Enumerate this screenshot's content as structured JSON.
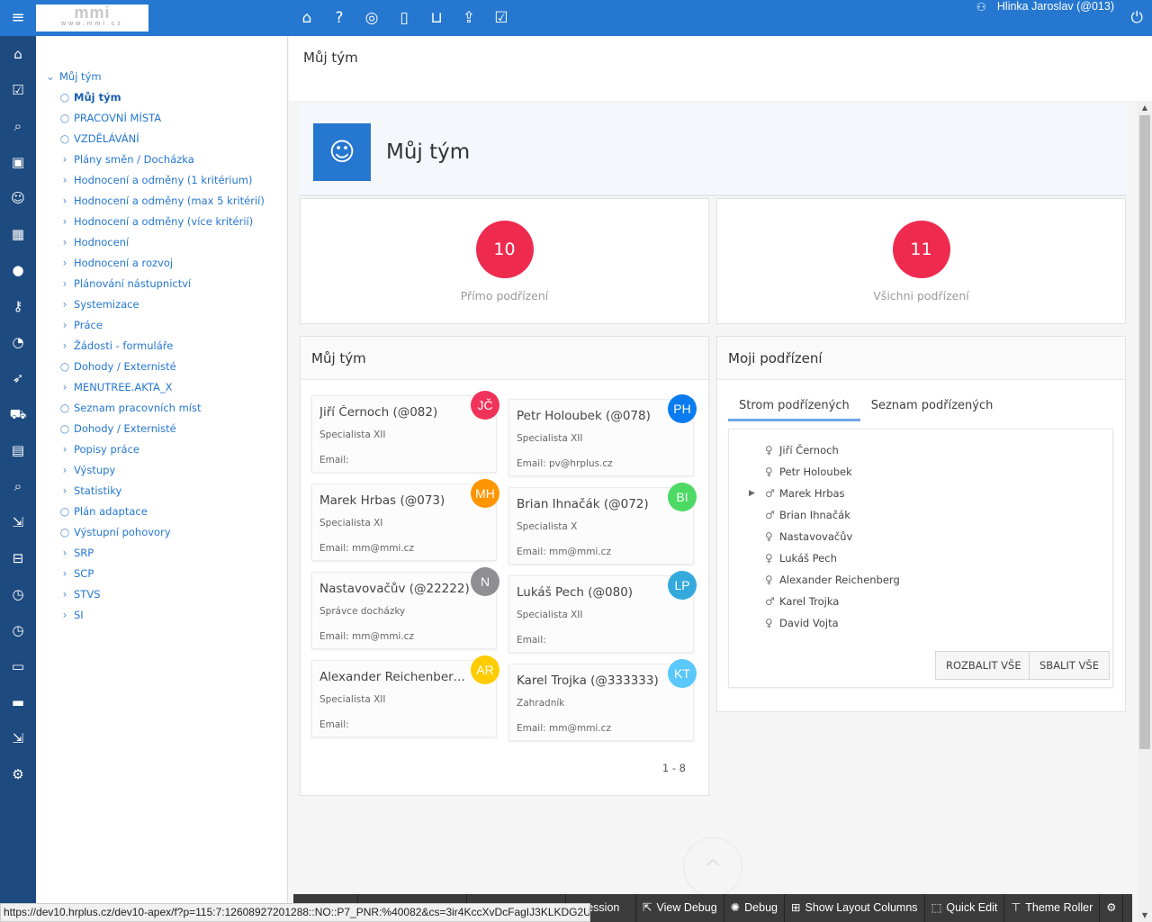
{
  "topbar": {
    "logo_text": "mmi",
    "logo_sub": "www.mmi.cz",
    "icons": [
      "home-icon",
      "help-icon",
      "lifebuoy-icon",
      "book-icon",
      "inbox-icon",
      "window-upload-icon",
      "window-check-icon"
    ],
    "user": "Hlinka Jaroslav (@013)"
  },
  "rail": [
    "home-icon",
    "window-check-icon",
    "window-search-icon",
    "contact-card-icon",
    "team-icon",
    "building-icon",
    "user-circle-icon",
    "user-key-icon",
    "dashboard-icon",
    "rocket-icon",
    "car-icon",
    "train-icon",
    "window-search-icon",
    "window-arrow-icon",
    "briefcase-icon",
    "clock-icon",
    "clock-icon",
    "money-icon",
    "ticket-icon",
    "window-arrow-icon",
    "gear-icon"
  ],
  "nav": [
    {
      "t": "root",
      "label": "Můj tým"
    },
    {
      "t": "circle",
      "label": "Můj tým",
      "active": true
    },
    {
      "t": "circle",
      "label": "PRACOVNÍ MÍSTA"
    },
    {
      "t": "circle",
      "label": "VZDĚLÁVÁNÍ"
    },
    {
      "t": "chev",
      "label": "Plány směn / Docházka"
    },
    {
      "t": "chev",
      "label": "Hodnocení a odměny (1 kritérium)"
    },
    {
      "t": "chev",
      "label": "Hodnocení a odměny (max 5 kritérií)"
    },
    {
      "t": "chev",
      "label": "Hodnocení a odměny (více kritérií)"
    },
    {
      "t": "chev",
      "label": "Hodnocení"
    },
    {
      "t": "chev",
      "label": "Hodnocení a rozvoj"
    },
    {
      "t": "chev",
      "label": "Plánování nástupnictví"
    },
    {
      "t": "chev",
      "label": "Systemizace"
    },
    {
      "t": "chev",
      "label": "Práce"
    },
    {
      "t": "chev",
      "label": "Žádosti - formuláře"
    },
    {
      "t": "circle",
      "label": "Dohody / Externisté"
    },
    {
      "t": "chev",
      "label": "MENUTREE.AKTA_X"
    },
    {
      "t": "circle",
      "label": "Seznam pracovních míst"
    },
    {
      "t": "circle",
      "label": "Dohody / Externisté"
    },
    {
      "t": "chev",
      "label": "Popisy práce"
    },
    {
      "t": "chev",
      "label": "Výstupy"
    },
    {
      "t": "chev",
      "label": "Statistiky"
    },
    {
      "t": "circle",
      "label": "Plán adaptace"
    },
    {
      "t": "circle",
      "label": "Výstupní pohovory"
    },
    {
      "t": "chev",
      "label": "SRP"
    },
    {
      "t": "chev",
      "label": "SCP"
    },
    {
      "t": "chev",
      "label": "STVS"
    },
    {
      "t": "chev",
      "label": "SI"
    }
  ],
  "breadcrumb": "Můj tým",
  "hero": {
    "title": "Můj tým",
    "icon": "team-icon"
  },
  "stats": [
    {
      "value": "10",
      "label": "Přímo podřízení"
    },
    {
      "value": "11",
      "label": "Všichni podřízení"
    }
  ],
  "team": {
    "title": "Můj tým",
    "pager": "1 - 8",
    "cards": [
      {
        "name": "Jiří Černoch (@082)",
        "role": "Specialista XII",
        "email": "Email:",
        "initials": "JČ",
        "color": "#f0335a"
      },
      {
        "name": "Petr Holoubek (@078)",
        "role": "Specialista XII",
        "email": "Email: pv@hrplus.cz",
        "initials": "PH",
        "color": "#0a7cf0"
      },
      {
        "name": "Marek Hrbas (@073)",
        "role": "Specialista XI",
        "email": "Email: mm@mmi.cz",
        "initials": "MH",
        "color": "#ff9500"
      },
      {
        "name": "Brian Ihnačák (@072)",
        "role": "Specialista X",
        "email": "Email: mm@mmi.cz",
        "initials": "BI",
        "color": "#4cd964"
      },
      {
        "name": "Nastavovačův (@22222)",
        "role": "Správce docházky",
        "email": "Email: mm@mmi.cz",
        "initials": "N",
        "color": "#8e8e93"
      },
      {
        "name": "Lukáš Pech (@080)",
        "role": "Specialista XII",
        "email": "Email:",
        "initials": "LP",
        "color": "#34aadc"
      },
      {
        "name": "Alexander Reichenberg (...",
        "role": "Specialista XII",
        "email": "Email:",
        "initials": "AR",
        "color": "#ffcc00"
      },
      {
        "name": "Karel Trojka (@333333)",
        "role": "Zahradník",
        "email": "Email: mm@mmi.cz",
        "initials": "KT",
        "color": "#5ac8fa"
      }
    ]
  },
  "subs": {
    "title": "Moji podřízení",
    "tabs": [
      "Strom podřízených",
      "Seznam podřízených"
    ],
    "tree": [
      {
        "name": "Jiří Černoch",
        "icon": "female-icon"
      },
      {
        "name": "Petr Holoubek",
        "icon": "female-icon"
      },
      {
        "name": "Marek Hrbas",
        "icon": "male-icon",
        "expandable": true
      },
      {
        "name": "Brian Ihnačák",
        "icon": "male-icon"
      },
      {
        "name": " Nastavovačův",
        "icon": "female-icon"
      },
      {
        "name": "Lukáš Pech",
        "icon": "female-icon"
      },
      {
        "name": "Alexander Reichenberg",
        "icon": "female-icon"
      },
      {
        "name": "Karel Trojka",
        "icon": "male-icon"
      },
      {
        "name": "David Vojta",
        "icon": "female-icon"
      }
    ],
    "expand": "ROZBALIT VŠE",
    "collapse": "SBALIT VŠE"
  },
  "devbar": [
    "",
    "",
    "",
    "ession",
    "View Debug",
    "Debug",
    "Show Layout Columns",
    "Quick Edit",
    "Theme Roller",
    ""
  ],
  "status_url": "https://dev10.hrplus.cz/dev10-apex/f?p=115:7:12608927201288::NO::P7_PNR:%40082&cs=3ir4KccXvDcFagIJ3KLKDG2Usd-c"
}
